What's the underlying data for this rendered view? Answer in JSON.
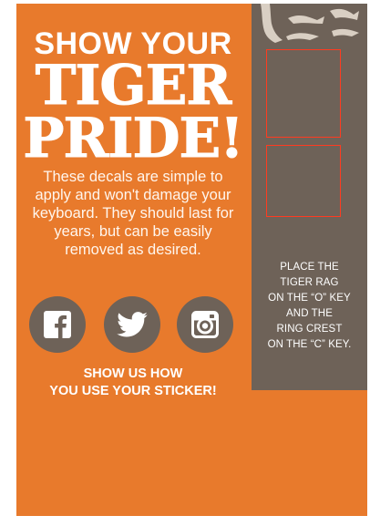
{
  "header": {
    "line1": "SHOW YOUR",
    "line2": "TIGER",
    "line3": "PRIDE!"
  },
  "description": "These decals are simple to apply and won't damage your keyboard. They should last for years, but can be easily removed as desired.",
  "social": {
    "items": [
      {
        "name": "facebook-icon"
      },
      {
        "name": "twitter-icon"
      },
      {
        "name": "instagram-icon"
      }
    ]
  },
  "cta": {
    "line1": "SHOW US HOW",
    "line2": "YOU USE YOUR STICKER!"
  },
  "panel": {
    "lines": [
      "PLACE THE",
      "TIGER RAG",
      "ON THE “O” KEY",
      "AND THE",
      "RING CREST",
      "ON THE “C” KEY."
    ]
  },
  "colors": {
    "background": "#e87a2c",
    "panel": "#6e6258",
    "slot_outline": "#ff3b20",
    "text": "#ffffff"
  }
}
